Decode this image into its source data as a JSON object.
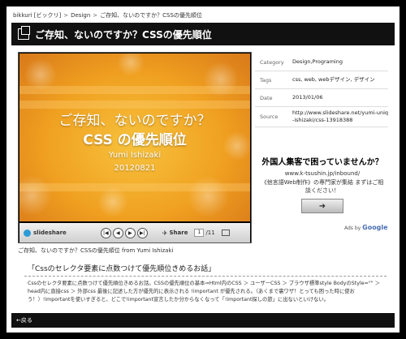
{
  "breadcrumb": {
    "items": [
      "bikkuri [ビックリ]",
      "Design",
      "ご存知、ないのですか？CSSの優先順位"
    ],
    "separator": ">"
  },
  "page": {
    "title": "ご存知、ないのですか？CSSの優先順位",
    "title_icon": "page-copy-icon"
  },
  "slide": {
    "title_line1": "ご存知、ないのですか？",
    "title_line2": "CSS の優先順位",
    "author": "Yumi Ishizaki",
    "date": "20120821",
    "background_color": "#f0a020"
  },
  "player": {
    "logo": "slideshare",
    "share_label": "Share",
    "current_page": "1",
    "total_pages": "/11",
    "buttons": [
      "first-icon",
      "prev-icon",
      "play-icon",
      "next-icon"
    ]
  },
  "caption": "ご存知、ないのですか？CSSの優先順位 from Yumi Ishizaki",
  "meta": {
    "rows": [
      {
        "key": "Category",
        "value": "Design,Programing"
      },
      {
        "key": "Tags",
        "value": "css, web, webデザイン, デザイン"
      },
      {
        "key": "Date",
        "value": "2013/01/06"
      },
      {
        "key": "Source",
        "value": "http://www.slideshare.net/yumi-uniq-ishizaki/css-13918388"
      }
    ]
  },
  "ad": {
    "headline": "外国人集客で困っていませんか？",
    "url": "www.k-tsushin.jp/inbound/",
    "body": "《他言語Web制作》の専門家が集結 まずはご相談ください！",
    "button_icon": "arrow-right-icon",
    "adsby_prefix": "Ads by",
    "adsby_brand": "Google"
  },
  "section": {
    "heading": "「Cssのセレクタ要素に点数つけて優先順位きめるお話」",
    "body": "Cssのセレクタ要素に点数つけて優先順位きめるお話。CSSの優先順位の基本⇒Html内のCSS ＞ ユーザーCSS ＞ ブラウザ標準style BodyのStyle=\"\" ＞ head内に直接css ＞ 外部css 最後に記述した方が優先的に表示される !important が優先される。（あくまで裏ワザ！とっても困った時に使おう！）!importantを使いすぎると、どこで!important宣言したか分からなくなって「!important探しの旅」に出ないといけない。"
  },
  "footer": {
    "back_label": "←戻る"
  }
}
